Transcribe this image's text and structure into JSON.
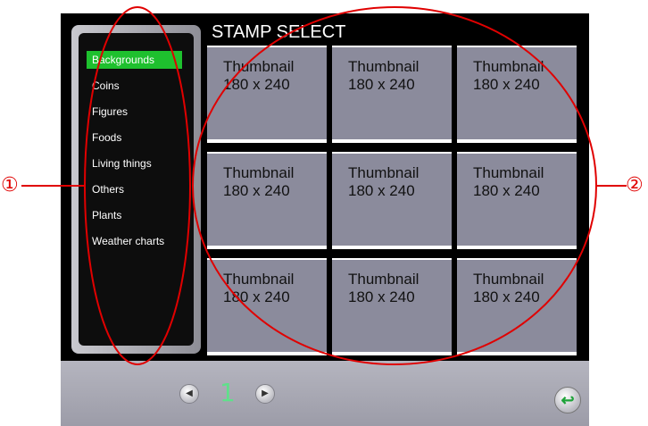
{
  "screen": {
    "title": "STAMP SELECT"
  },
  "categories": [
    "Backgrounds",
    "Coins",
    "Figures",
    "Foods",
    "Living things",
    "Others",
    "Plants",
    "Weather charts"
  ],
  "selected_category": "Backgrounds",
  "thumbnails": [
    {
      "line1": "Thumbnail",
      "line2": "180 x 240"
    },
    {
      "line1": "Thumbnail",
      "line2": "180 x 240"
    },
    {
      "line1": "Thumbnail",
      "line2": "180 x 240"
    },
    {
      "line1": "Thumbnail",
      "line2": "180 x 240"
    },
    {
      "line1": "Thumbnail",
      "line2": "180 x 240"
    },
    {
      "line1": "Thumbnail",
      "line2": "180 x 240"
    },
    {
      "line1": "Thumbnail",
      "line2": "180 x 240"
    },
    {
      "line1": "Thumbnail",
      "line2": "180 x 240"
    },
    {
      "line1": "Thumbnail",
      "line2": "180 x 240"
    }
  ],
  "pagination": {
    "current_page": "1",
    "prev_icon": "chevron-left-icon",
    "next_icon": "chevron-right-icon"
  },
  "back_icon": "return-arrow-icon",
  "annotations": {
    "marker1": "①",
    "marker2": "②"
  },
  "colors": {
    "active_category": "#1ec02e",
    "annotation": "#e00000",
    "page_number": "#5fe08a"
  }
}
